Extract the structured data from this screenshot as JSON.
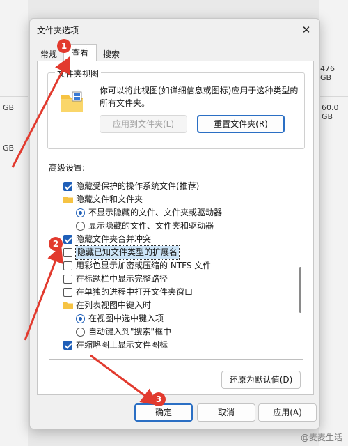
{
  "background": {
    "right_sizes": [
      "476 GB",
      "60.0 GB"
    ],
    "left_sizes": [
      "GB",
      "GB"
    ]
  },
  "dialog": {
    "title": "文件夹选项",
    "tabs": [
      {
        "label": "常规"
      },
      {
        "label": "查看"
      },
      {
        "label": "搜索"
      }
    ],
    "folder_views": {
      "label": "文件夹视图",
      "description": "你可以将此视图(如详细信息或图标)应用于这种类型的所有文件夹。",
      "apply_button": "应用到文件夹(L)",
      "reset_button": "重置文件夹(R)"
    },
    "advanced_label": "高级设置:",
    "advanced_items": [
      {
        "kind": "checkbox",
        "checked": true,
        "label": "隐藏受保护的操作系统文件(推荐)"
      },
      {
        "kind": "folder",
        "label": "隐藏文件和文件夹"
      },
      {
        "kind": "radio",
        "checked": true,
        "label": "不显示隐藏的文件、文件夹或驱动器"
      },
      {
        "kind": "radio",
        "checked": false,
        "label": "显示隐藏的文件、文件夹和驱动器"
      },
      {
        "kind": "checkbox",
        "checked": true,
        "label": "隐藏文件夹合并冲突"
      },
      {
        "kind": "checkbox",
        "checked": false,
        "label": "隐藏已知文件类型的扩展名"
      },
      {
        "kind": "checkbox",
        "checked": false,
        "label": "用彩色显示加密或压缩的 NTFS 文件"
      },
      {
        "kind": "checkbox",
        "checked": false,
        "label": "在标题栏中显示完整路径"
      },
      {
        "kind": "checkbox",
        "checked": false,
        "label": "在单独的进程中打开文件夹窗口"
      },
      {
        "kind": "folder",
        "label": "在列表视图中键入时"
      },
      {
        "kind": "radio",
        "checked": true,
        "label": "在视图中选中键入项"
      },
      {
        "kind": "radio",
        "checked": false,
        "label": "自动键入到\"搜索\"框中"
      },
      {
        "kind": "checkbox",
        "checked": true,
        "label": "在缩略图上显示文件图标"
      }
    ],
    "restore_button": "还原为默认值(D)",
    "ok_button": "确定",
    "cancel_button": "取消",
    "apply_button": "应用(A)"
  },
  "badges": [
    "1",
    "2",
    "3"
  ],
  "watermark": "@麦麦生活",
  "colors": {
    "accent": "#1f5fb8",
    "badge": "#e23a2e",
    "arrow": "#e23a2e"
  }
}
